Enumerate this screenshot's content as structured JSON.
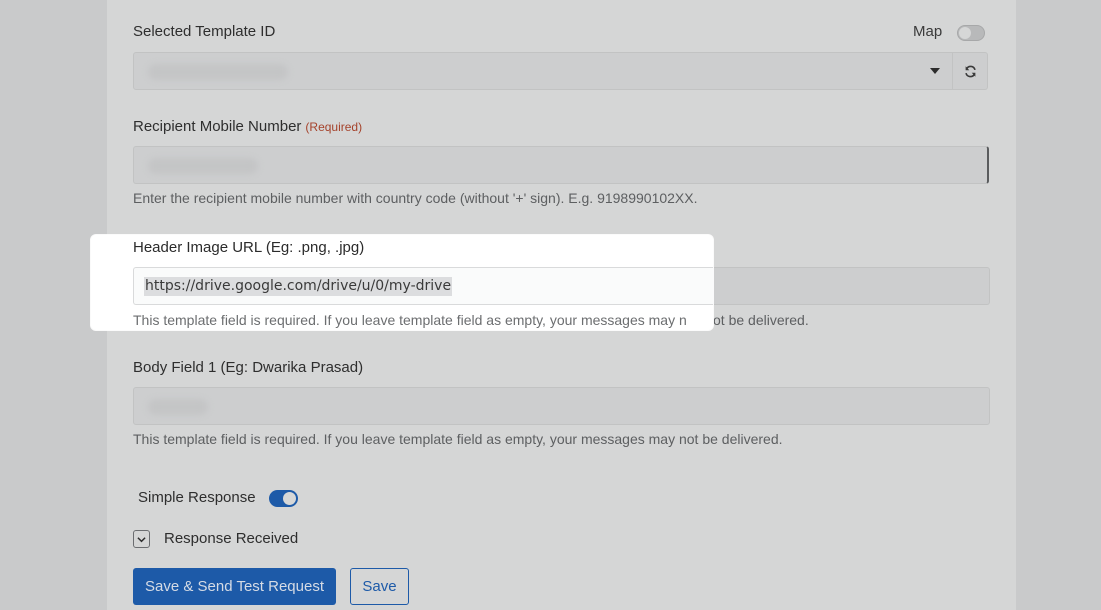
{
  "template": {
    "label": "Selected Template ID",
    "map_label": "Map"
  },
  "recipient": {
    "label": "Recipient Mobile Number",
    "required": "(Required)",
    "help": "Enter the recipient mobile number with country code (without '+' sign). E.g. 9198990102XX."
  },
  "header_image": {
    "label": "Header Image URL (Eg: .png, .jpg)",
    "value": "https://drive.google.com/drive/u/0/my-drive",
    "help_left": "This template field is required. If you leave template field as empty, your messages may n",
    "help_right": "ot be delivered."
  },
  "body_field": {
    "label": "Body Field 1 (Eg: Dwarika Prasad)",
    "help": "This template field is required. If you leave template field as empty, your messages may not be delivered."
  },
  "simple_response": {
    "label": "Simple Response",
    "enabled": true
  },
  "response_received": {
    "label": "Response Received"
  },
  "buttons": {
    "save_send": "Save & Send Test Request",
    "save": "Save"
  },
  "colors": {
    "accent": "#1d5aa8",
    "required": "#a5432c"
  }
}
